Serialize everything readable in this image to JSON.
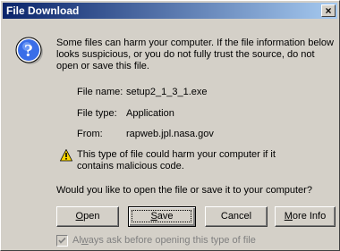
{
  "dialog": {
    "title": "File Download",
    "close_glyph": "×"
  },
  "message": "Some files can harm your computer. If the file information below looks suspicious, or you do not fully trust the source, do not open or save this file.",
  "file_info": {
    "name_label": "File name:",
    "name_value": "setup2_1_3_1.exe",
    "type_label": "File type:",
    "type_value": "Application",
    "from_label": "From:",
    "from_value": "rapweb.jpl.nasa.gov"
  },
  "caution": "This type of file could harm your computer if it contains malicious code.",
  "question": "Would you like to open the file or save it to your computer?",
  "buttons": {
    "open": {
      "accel": "O",
      "rest": "pen"
    },
    "save": {
      "accel": "S",
      "rest": "ave"
    },
    "cancel": "Cancel",
    "more_info": {
      "accel": "M",
      "rest": "ore Info"
    }
  },
  "checkbox": {
    "label_pre": "Al",
    "label_accel": "w",
    "label_post": "ays ask before opening this type of file",
    "checked": true
  },
  "icons": {
    "question": "question-icon",
    "warning": "warning-icon"
  },
  "colors": {
    "titlebar_start": "#0a246a",
    "titlebar_end": "#a6caf0",
    "face": "#d4d0c8"
  }
}
